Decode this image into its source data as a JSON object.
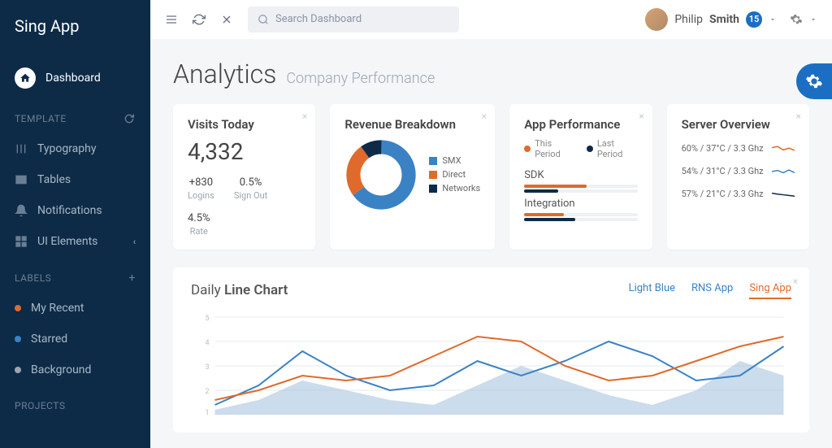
{
  "brand": {
    "a": "Sing",
    "b": "App"
  },
  "nav": {
    "dashboard": "Dashboard"
  },
  "sections": {
    "template": "TEMPLATE",
    "labels": "LABELS",
    "projects": "PROJECTS"
  },
  "template_items": [
    "Typography",
    "Tables",
    "Notifications",
    "UI Elements"
  ],
  "label_items": [
    {
      "t": "My Recent",
      "c": "#e06a2b"
    },
    {
      "t": "Starred",
      "c": "#3b82c4"
    },
    {
      "t": "Background",
      "c": "#9aa5b1"
    }
  ],
  "search": {
    "placeholder": "Search Dashboard"
  },
  "user": {
    "first": "Philip",
    "last": "Smith",
    "badge": "15"
  },
  "page": {
    "title": "Analytics",
    "sub": "Company Performance"
  },
  "visits": {
    "title": "Visits Today",
    "value": "4,332",
    "s1v": "+830",
    "s1l": "Logins",
    "s2v": "0.5%",
    "s2l": "Sign Out",
    "s3v": "4.5%",
    "s3l": "Rate"
  },
  "revenue": {
    "title": "Revenue Breakdown",
    "legend": [
      {
        "t": "SMX",
        "c": "#3b82c4"
      },
      {
        "t": "Direct",
        "c": "#e06a2b"
      },
      {
        "t": "Networks",
        "c": "#0d2b47"
      }
    ]
  },
  "perf": {
    "title": "App Performance",
    "legend": [
      {
        "t": "This Period",
        "c": "#e06a2b"
      },
      {
        "t": "Last Period",
        "c": "#0d2b47"
      }
    ],
    "m": [
      {
        "l": "SDK",
        "a": 55,
        "b": 30
      },
      {
        "l": "Integration",
        "a": 35,
        "b": 45
      }
    ]
  },
  "server": {
    "title": "Server Overview",
    "rows": [
      {
        "t": "60% / 37°C / 3.3 Ghz",
        "c": "#e06a2b"
      },
      {
        "t": "54% / 31°C / 3.3 Ghz",
        "c": "#3b82c4"
      },
      {
        "t": "57% / 21°C / 3.3 Ghz",
        "c": "#0d2b47"
      }
    ]
  },
  "line": {
    "title_a": "Daily",
    "title_b": "Line Chart",
    "tabs": [
      "Light Blue",
      "RNS App",
      "Sing App"
    ]
  },
  "chart_data": {
    "revenue_donut": {
      "type": "pie",
      "series": [
        {
          "name": "SMX",
          "value": 65
        },
        {
          "name": "Direct",
          "value": 25
        },
        {
          "name": "Networks",
          "value": 10
        }
      ]
    },
    "app_perf": {
      "type": "bar",
      "metrics": [
        {
          "name": "SDK",
          "this": 55,
          "last": 30
        },
        {
          "name": "Integration",
          "this": 35,
          "last": 45
        }
      ]
    },
    "server_spark": [
      {
        "name": "60% / 37°C / 3.3 Ghz",
        "values": [
          3,
          3.5,
          2,
          2.8,
          1.8
        ]
      },
      {
        "name": "54% / 31°C / 3.3 Ghz",
        "values": [
          2.5,
          3,
          2,
          3.2,
          2
        ]
      },
      {
        "name": "57% / 21°C / 3.3 Ghz",
        "values": [
          3,
          2.6,
          2.3,
          2,
          1.7
        ]
      }
    ],
    "daily_line": {
      "type": "line",
      "ylim": [
        1,
        5
      ],
      "x": [
        1,
        2,
        3,
        4,
        5,
        6,
        7,
        8,
        9,
        10,
        11,
        12,
        13,
        14
      ],
      "series": [
        {
          "name": "Light Blue",
          "values": [
            1.2,
            1.6,
            2.4,
            2.0,
            1.6,
            1.4,
            2.2,
            3.0,
            2.4,
            1.8,
            1.4,
            2.0,
            3.2,
            2.6
          ]
        },
        {
          "name": "RNS App",
          "values": [
            1.4,
            2.2,
            3.6,
            2.6,
            2.0,
            2.2,
            3.2,
            2.6,
            3.2,
            4.0,
            3.4,
            2.4,
            2.6,
            3.8
          ]
        },
        {
          "name": "Sing App",
          "values": [
            1.6,
            2.0,
            2.6,
            2.4,
            2.6,
            3.4,
            4.2,
            4.0,
            3.0,
            2.4,
            2.6,
            3.2,
            3.8,
            4.2
          ]
        }
      ]
    }
  }
}
